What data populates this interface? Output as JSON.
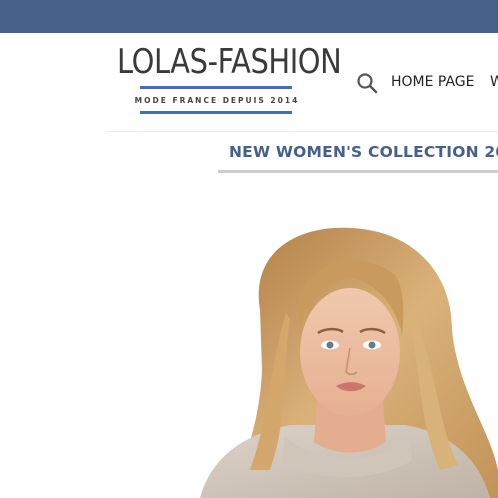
{
  "brand": {
    "name": "LOLAS-FASHION",
    "tagline": "MODE FRANCE DEPUIS 2014",
    "accent_color": "#3f6fb7"
  },
  "top_bar": {
    "color": "#456189"
  },
  "nav": {
    "search_icon": "search-icon",
    "items": [
      {
        "label": "HOME PAGE"
      },
      {
        "label": "W"
      }
    ]
  },
  "main": {
    "section_title": "NEW WOMEN'S COLLECTION 20",
    "title_color": "#456189",
    "hero_image": "woman-portrait-blonde-wavy-hair-beige-knit"
  }
}
